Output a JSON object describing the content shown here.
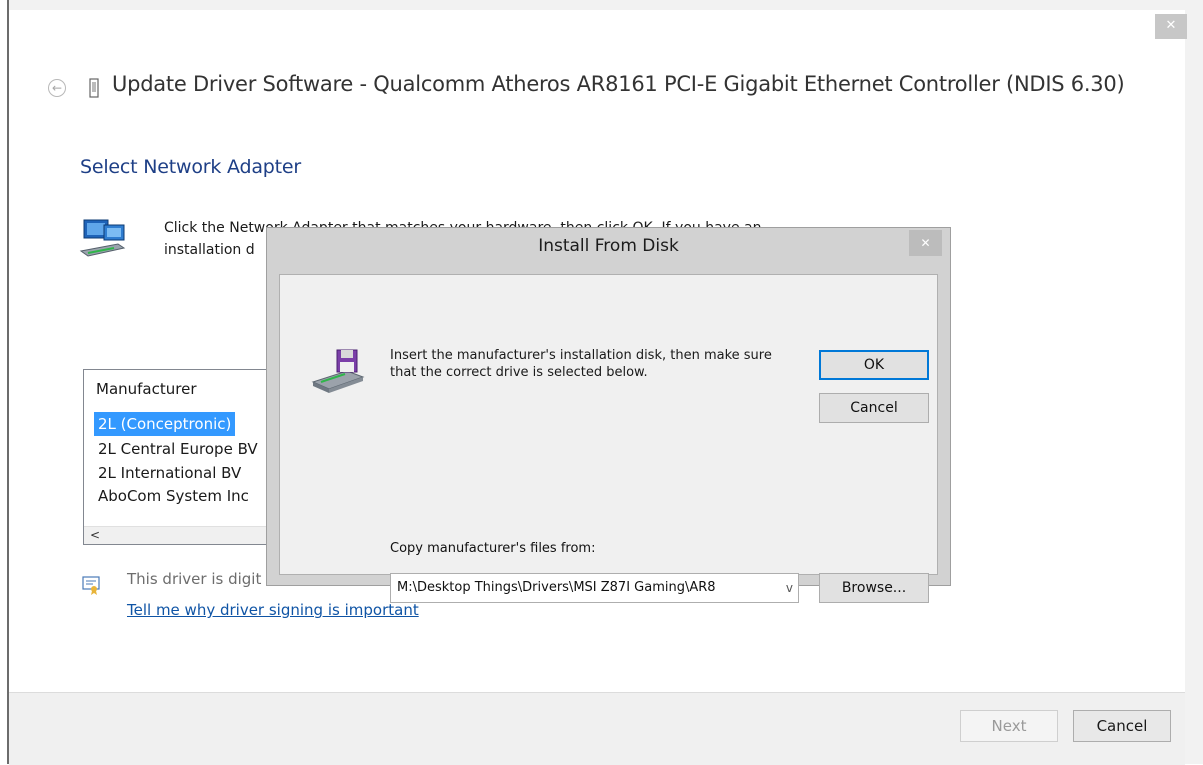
{
  "window": {
    "title": "Update Driver Software - Qualcomm Atheros AR8161 PCI-E Gigabit Ethernet Controller (NDIS 6.30)",
    "close_glyph": "✕",
    "back_glyph": "←"
  },
  "page": {
    "heading": "Select Network Adapter",
    "instruction_line1": "Click the Network Adapter that matches your hardware, then click OK. If you have an",
    "instruction_line2": "installation d"
  },
  "manufacturer_list": {
    "header": "Manufacturer",
    "items": [
      {
        "label": "2L (Conceptronic)",
        "selected": true
      },
      {
        "label": "2L Central Europe BV",
        "selected": false
      },
      {
        "label": "2L International BV",
        "selected": false
      },
      {
        "label": "AboCom System Inc",
        "selected": false
      }
    ],
    "scroll_left_glyph": "<"
  },
  "signing": {
    "status_text": "This driver is digit",
    "link_text": "Tell me why driver signing is important"
  },
  "footer": {
    "next_label": "Next",
    "cancel_label": "Cancel"
  },
  "install_dialog": {
    "title": "Install From Disk",
    "close_glyph": "✕",
    "message": "Insert the manufacturer's installation disk, then make sure that the correct drive is selected below.",
    "ok_label": "OK",
    "cancel_label": "Cancel",
    "copy_label": "Copy manufacturer's files from:",
    "path_value": "M:\\Desktop Things\\Drivers\\MSI Z87I Gaming\\AR8",
    "dropdown_glyph": "v",
    "browse_label": "Browse..."
  },
  "icons": {
    "title_icon": "device-icon",
    "network_icon": "network-adapter-icon",
    "certificate_icon": "certificate-icon",
    "disk_icon": "disk-drive-icon"
  },
  "colors": {
    "heading_blue": "#1e3f86",
    "link_blue": "#0f54a5",
    "selection_blue": "#3399ff",
    "focus_blue": "#0078d7"
  }
}
